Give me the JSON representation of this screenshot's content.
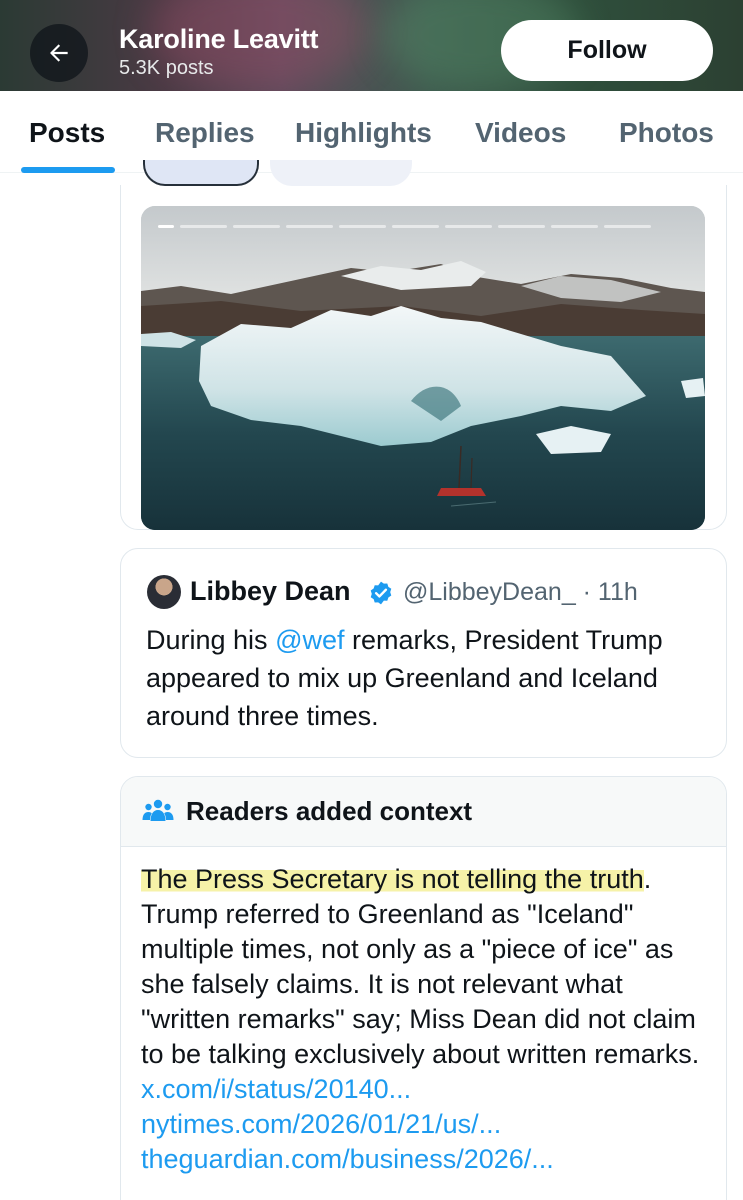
{
  "header": {
    "profile_name": "Karoline Leavitt",
    "post_count": "5.3K posts",
    "follow_label": "Follow"
  },
  "tabs": [
    {
      "label": "Posts",
      "active": true
    },
    {
      "label": "Replies",
      "active": false
    },
    {
      "label": "Highlights",
      "active": false
    },
    {
      "label": "Videos",
      "active": false
    },
    {
      "label": "Photos",
      "active": false
    }
  ],
  "media": {
    "story_segments": 10,
    "accent_color": "#1d9bf0"
  },
  "quoted_post": {
    "author_name": "Libbey Dean",
    "handle_time": "@LibbeyDean_ · 11h",
    "text_before": "During his ",
    "mention": "@wef",
    "text_after": " remarks, President Trump appeared to mix up Greenland and Iceland around three times."
  },
  "community_note": {
    "title": "Readers added context",
    "highlighted_text": "The Press Secretary is not telling the truth",
    "body_text": ". Trump referred to Greenland as \"Iceland\" multiple times, not only as a \"piece of ice\" as she falsely claims. It is not relevant what \"written remarks\" say; Miss Dean did not claim to be talking exclusively about written remarks. ",
    "links": [
      "x.com/i/status/20140...",
      "nytimes.com/2026/01/21/us/...",
      "theguardian.com/business/2026/..."
    ]
  }
}
